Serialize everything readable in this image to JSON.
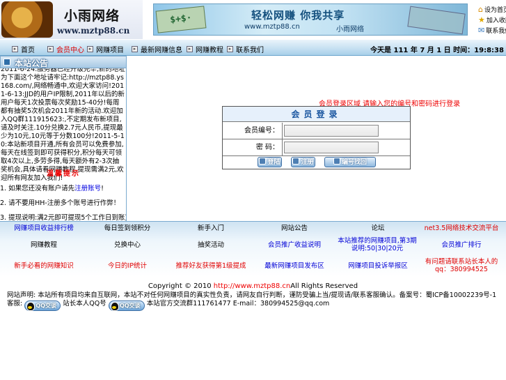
{
  "header": {
    "logo_title": "小雨网络",
    "logo_url": "www.mztp88.cn",
    "banner": {
      "bill_text": "$+$·",
      "slogan": "轻松网赚  你我共享",
      "url": "www.mztp88.cn",
      "name": "小雨网络"
    },
    "quick_links": [
      {
        "icon": "home-icon",
        "label": "设为首页"
      },
      {
        "icon": "star-icon",
        "label": "加入收藏"
      },
      {
        "icon": "mail-icon",
        "label": "联系我们"
      }
    ]
  },
  "nav": {
    "items": [
      {
        "label": "首页"
      },
      {
        "label": "会员中心"
      },
      {
        "label": "网赚项目"
      },
      {
        "label": "最新网赚信息"
      },
      {
        "label": "网赚教程"
      },
      {
        "label": "联系我们"
      }
    ],
    "active_index": 1,
    "clock": "今天是 111 年 7 月 1 日 时间：19:8:38"
  },
  "notice": {
    "title": "本站公告",
    "body": "2011-6-24:服务器已经升级完毕,新的地址为下面这个地址请牢记:http://mztp88.ys168.com/,网络畅通中,欢迎大家访问!2011-6-13:JJD的用户IP限制,2011年以后的新用户每天1次投票每次奖励15-40分!每周都有抽奖5次机会2011年新的活动.欢迎加入QQ群111915623:,不定期发布新项目,请及时关注.10分兑换2.7元人民币,提现最少为10元,10元等于分数100分!2011-5-10:本站新项目开通,所有会员可以免费参加,每天在线签到即可获得积分,积分每天可领取4次以上,多劳多得,每天额外有2-3次抽奖机会,具体请看网赚教程,提现需满2元,欢迎所有网友加入我们!",
    "tips_title": "温馨提示",
    "tips": [
      {
        "text": "如果您还没有账户请先",
        "link": "注册账号",
        "after": "!"
      },
      {
        "text": "请不要用HH-注册多个账号进行作弊！",
        "link": "",
        "after": ""
      },
      {
        "text": "提现说明:满2元即可提现5个工作日到账",
        "link": "",
        "after": ")."
      }
    ]
  },
  "login": {
    "notice": "会员登录区域 请输入您的编号和密码进行登录",
    "title": "会员登录",
    "user_label": "会员编号：",
    "pass_label": "密  码：",
    "user_value": "",
    "pass_value": "",
    "login_btn": "登陆",
    "register_btn": "注册",
    "recover_btn": "编号找回"
  },
  "links": [
    [
      "网赚项目收益排行榜",
      "每日签到领积分",
      "新手入门",
      "网站公告",
      "论坛",
      "net3.5网络技术交流平台"
    ],
    [
      "网赚教程",
      "兑换中心",
      "抽奖活动",
      "会员推广收益说明",
      "本站推荐的网赚项目,第3期说明:50|30|20元",
      "会员推广排行"
    ],
    [
      "新手必看的网赚知识",
      "今日的IP统计",
      "推荐好友获得第1级提成",
      "最新网赚项目发布区",
      "网赚项目投诉举报区",
      "有问题请联系站长本人的qq：380994525"
    ]
  ],
  "footer": {
    "copyright_prefix": "Copyright © 2010 ",
    "copyright_link": "http://www.mztp88.cn",
    "copyright_suffix": "All Rights Reserved",
    "info_prefix": "网站声明: 本站所有项目均来自互联网，本站不对任何网赚项目的真实性负责，请网友自行判断，谨防受骗上当/提现请/联系客服确认。备案号：蜀ICP备10002239号-1  客服:",
    "qq_label": "QQ交谈",
    "info_middle": " 站长本人QQ号",
    "info_suffix": " 本站官方交流群111761477 E-mail：380994525@qq.com"
  },
  "colors": {
    "nav_gradient_bottom": "#a8cfe9",
    "accent_red": "#e00000",
    "link_blue": "#0000d6"
  }
}
